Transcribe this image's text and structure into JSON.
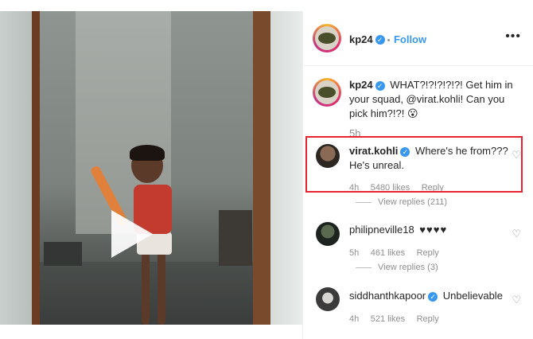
{
  "post": {
    "author": "kp24",
    "follow_label": "Follow",
    "more_icon": "more-dots-icon",
    "caption": {
      "username": "kp24",
      "text": "WHAT?!?!?!?!?! Get him in your squad, @virat.kohli! Can you pick him?!?! 😮",
      "time": "5h"
    }
  },
  "comments": [
    {
      "username": "virat.kohli",
      "text": "Where's he from??? He's unreal.",
      "time": "4h",
      "likes": "5480 likes",
      "reply": "Reply",
      "view_replies": "View replies (211)",
      "highlighted": true
    },
    {
      "username": "philipneville18",
      "text": "♥♥♥♥",
      "time": "5h",
      "likes": "461 likes",
      "reply": "Reply",
      "view_replies": "View replies (3)"
    },
    {
      "username": "siddhanthkapoor",
      "text": "Unbelievable",
      "time": "4h",
      "likes": "521 likes",
      "reply": "Reply"
    }
  ],
  "colors": {
    "link": "#3897f0",
    "verified": "#3897f0",
    "highlight": "#e8232f",
    "muted": "#8e8e8e"
  }
}
